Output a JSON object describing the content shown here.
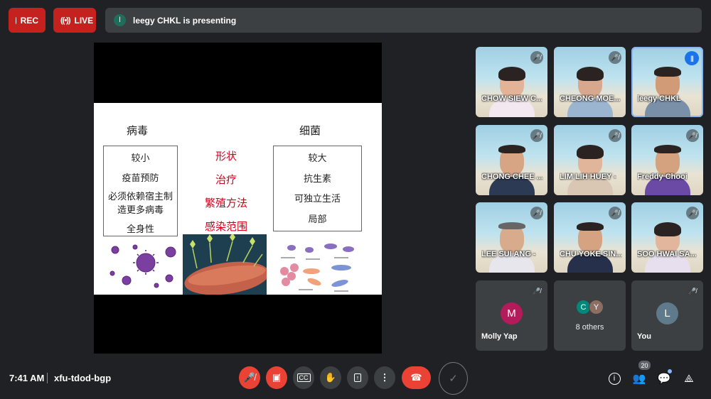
{
  "top": {
    "rec_label": "REC",
    "live_label": "LIVE",
    "presenter_initial": "l",
    "presenting_text": "leegy CHKL is presenting"
  },
  "slide": {
    "virus_title": "病毒",
    "bacteria_title": "细菌",
    "virus_items": [
      "较小",
      "疫苗预防",
      "必须依赖宿主制",
      "造更多病毒",
      "全身性"
    ],
    "middle_items": [
      "形状",
      "治疗",
      "繁殖方法",
      "感染范围"
    ],
    "bacteria_items": [
      "较大",
      "抗生素",
      "可独立生活",
      "局部"
    ]
  },
  "participants": [
    {
      "name": "CHOW SIEW C...",
      "muted": true
    },
    {
      "name": "CHEONG MOE...",
      "muted": true
    },
    {
      "name": "leegy CHKL",
      "speaking": true
    },
    {
      "name": "CHONG CHEE ...",
      "muted": true
    },
    {
      "name": "LIM LIH HUEY -",
      "muted": true
    },
    {
      "name": "Freddy Chooi",
      "muted": true
    },
    {
      "name": "LEE SUI ANG -",
      "muted": true
    },
    {
      "name": "CHU YOKE SIN...",
      "muted": true
    },
    {
      "name": "SOO HWAI SA...",
      "muted": true
    },
    {
      "name": "Molly Yap",
      "initial": "M",
      "color": "#b31b5a",
      "muted": true
    },
    {
      "name": "8 others",
      "initials": [
        "C",
        "Y"
      ],
      "colors": [
        "#00897b",
        "#8d6e63"
      ]
    },
    {
      "name": "You",
      "initial": "L",
      "color": "#5f7a8a",
      "muted": true
    }
  ],
  "bottom": {
    "time": "7:41 AM",
    "meeting_code": "xfu-tdod-bgp",
    "participant_count": "20"
  },
  "colors": {
    "background": "#202124",
    "red": "#ea4335",
    "tile": "#3c4043"
  }
}
